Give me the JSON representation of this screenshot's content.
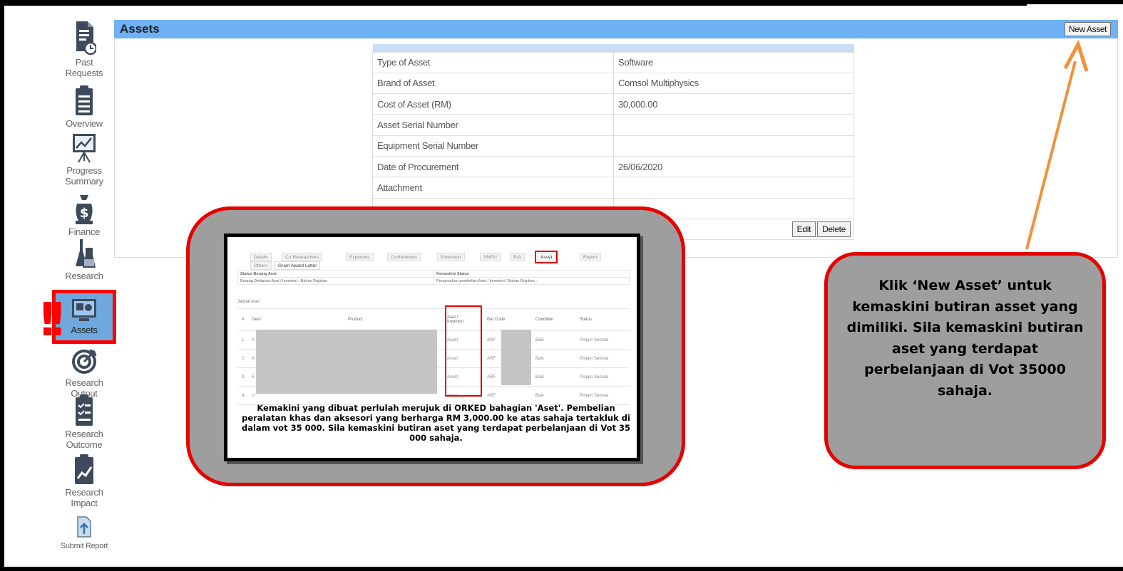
{
  "panel": {
    "title": "Assets",
    "new_asset_label": "New Asset"
  },
  "sidebar": {
    "items": [
      {
        "label": "Past Requests",
        "icon": "document-clock-icon"
      },
      {
        "label": "Overview",
        "icon": "clipboard-icon"
      },
      {
        "label": "Progress Summary",
        "icon": "presentation-chart-icon"
      },
      {
        "label": "Finance",
        "icon": "money-bag-icon"
      },
      {
        "label": "Research Activities",
        "icon": "lab-flask-icon"
      },
      {
        "label": "Assets",
        "icon": "assets-monitor-icon"
      },
      {
        "label": "Research Output",
        "icon": "target-icon"
      },
      {
        "label": "Research Outcome",
        "icon": "checklist-icon"
      },
      {
        "label": "Research Impact",
        "icon": "impact-chart-icon"
      },
      {
        "label": "Submit Report",
        "icon": "submit-report-icon"
      }
    ]
  },
  "asset_details": {
    "rows": [
      {
        "key": "Type of Asset",
        "value": "Software"
      },
      {
        "key": "Brand of Asset",
        "value": "Comsol Multiphysics"
      },
      {
        "key": "Cost of Asset (RM)",
        "value": "30,000.00"
      },
      {
        "key": "Asset Serial Number",
        "value": ""
      },
      {
        "key": "Equipment Serial Number",
        "value": ""
      },
      {
        "key": "Date of Procurement",
        "value": "26/06/2020"
      },
      {
        "key": "Attachment",
        "value": ""
      }
    ],
    "edit_label": "Edit",
    "delete_label": "Delete"
  },
  "inner_screenshot": {
    "tabs_row1": [
      "Details",
      "Co-Researchers",
      "Expenses",
      "Conferences",
      "Extension",
      "SMPU",
      "R/A",
      "Asset",
      "Report"
    ],
    "tabs_row2": [
      "Others",
      "Grant Award Letter"
    ],
    "status_headers": [
      "Status Borang Aset",
      "Kemaskini Status"
    ],
    "status_values": [
      "Borang Deklarasi Aset / Inventori / Bahan Rujukan :",
      "Pengesahan pembelian Aset / Inventori / Bahan Rujukan :"
    ],
    "section_label": "Jadual Aset",
    "columns": [
      "#",
      "Desc",
      "Product",
      "Aset / Inventori",
      "Bar Code",
      "Condition",
      "Status"
    ],
    "rows": [
      {
        "no": "1.",
        "desc": "A",
        "type": "Asset",
        "barcode": "ARF",
        "condition": "Baik",
        "status": "Pinjam Semula"
      },
      {
        "no": "2.",
        "desc": "A",
        "type": "Asset",
        "barcode": "ARF",
        "condition": "Baik",
        "status": "Pinjam Semula"
      },
      {
        "no": "3.",
        "desc": "E",
        "type": "Asset",
        "barcode": "ARF",
        "condition": "Baik",
        "status": "Pinjam Semula"
      },
      {
        "no": "4.",
        "desc": "U",
        "type": "Asset",
        "barcode": "ARF",
        "condition": "Baik",
        "status": "Pinjam Semula"
      }
    ],
    "caption": "Kemakini yang dibuat perlulah merujuk di ORKED bahagian 'Aset'. Pembelian peralatan khas dan aksesori yang berharga RM 3,000.00 ke atas sahaja tertakluk di dalam vot 35 000. Sila kemaskini butiran aset yang terdapat perbelanjaan di Vot 35 000 sahaja."
  },
  "note": {
    "text": "Klik ‘New Asset’ untuk kemaskini butiran asset yang dimiliki. Sila kemaskini butiran aset yang terdapat perbelanjaan di Vot 35000 sahaja."
  },
  "colors": {
    "header_blue": "#6fb1f5",
    "highlight_red": "#e60000",
    "arrow_orange": "#f0913a",
    "callout_gray": "#9e9e9e"
  }
}
